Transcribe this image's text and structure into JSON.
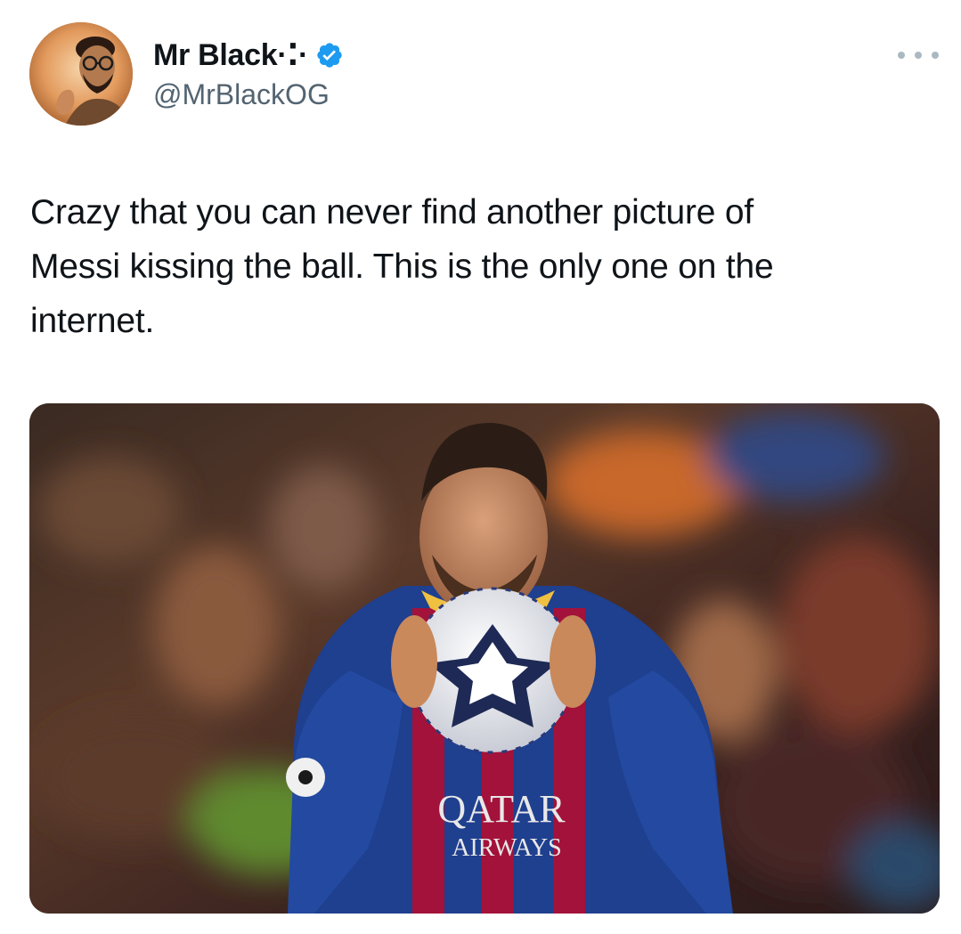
{
  "author": {
    "display_name": "Mr Black·⁚·",
    "handle": "@MrBlackOG",
    "verified": true,
    "avatar_icon": "profile-avatar",
    "verified_icon": "verified-badge-icon",
    "more_icon": "more-options-icon"
  },
  "tweet": {
    "text": "Crazy that you can never find another picture of\nMessi kissing the ball. This is the only one on the\ninternet."
  },
  "media": {
    "shirt_sponsor_line1": "QATAR",
    "shirt_sponsor_line2": "AIRWAYS"
  },
  "colors": {
    "verified_blue": "#1d9bf0",
    "handle_gray": "#536471",
    "text_dark": "#0f1419",
    "kit_blue": "#1f3f8f",
    "kit_red": "#a3123a"
  }
}
